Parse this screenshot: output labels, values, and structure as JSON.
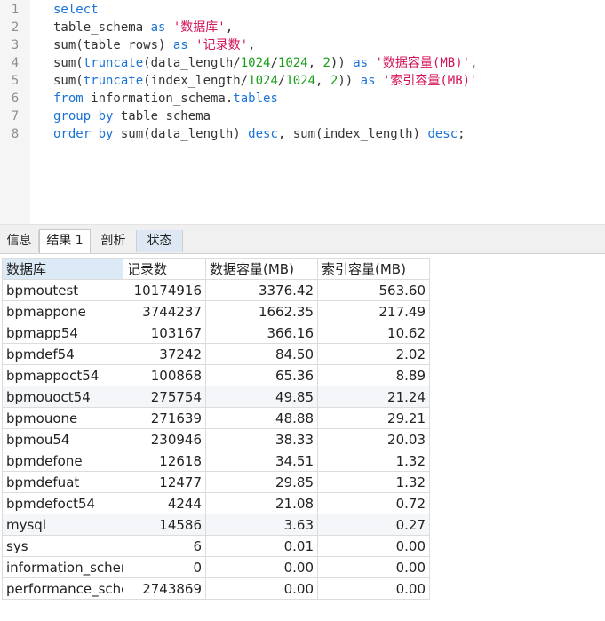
{
  "editor": {
    "lines": [
      {
        "n": "1",
        "tokens": [
          [
            "kw",
            "select"
          ]
        ]
      },
      {
        "n": "2",
        "tokens": [
          [
            "plain",
            "table_schema "
          ],
          [
            "kw",
            "as"
          ],
          [
            "plain",
            " "
          ],
          [
            "str",
            "'数据库'"
          ],
          [
            "plain",
            ","
          ]
        ]
      },
      {
        "n": "3",
        "tokens": [
          [
            "plain",
            "sum(table_rows) "
          ],
          [
            "kw",
            "as"
          ],
          [
            "plain",
            " "
          ],
          [
            "str",
            "'记录数'"
          ],
          [
            "plain",
            ","
          ]
        ]
      },
      {
        "n": "4",
        "tokens": [
          [
            "plain",
            "sum("
          ],
          [
            "fn",
            "truncate"
          ],
          [
            "plain",
            "(data_length/"
          ],
          [
            "num",
            "1024"
          ],
          [
            "plain",
            "/"
          ],
          [
            "num",
            "1024"
          ],
          [
            "plain",
            ", "
          ],
          [
            "num",
            "2"
          ],
          [
            "plain",
            ")) "
          ],
          [
            "kw",
            "as"
          ],
          [
            "plain",
            " "
          ],
          [
            "str",
            "'数据容量(MB)'"
          ],
          [
            "plain",
            ","
          ]
        ]
      },
      {
        "n": "5",
        "tokens": [
          [
            "plain",
            "sum("
          ],
          [
            "fn",
            "truncate"
          ],
          [
            "plain",
            "(index_length/"
          ],
          [
            "num",
            "1024"
          ],
          [
            "plain",
            "/"
          ],
          [
            "num",
            "1024"
          ],
          [
            "plain",
            ", "
          ],
          [
            "num",
            "2"
          ],
          [
            "plain",
            ")) "
          ],
          [
            "kw",
            "as"
          ],
          [
            "plain",
            " "
          ],
          [
            "str",
            "'索引容量(MB)'"
          ]
        ]
      },
      {
        "n": "6",
        "tokens": [
          [
            "kw",
            "from"
          ],
          [
            "plain",
            " information_schema."
          ],
          [
            "fn",
            "tables"
          ]
        ]
      },
      {
        "n": "7",
        "tokens": [
          [
            "kw",
            "group by"
          ],
          [
            "plain",
            " table_schema"
          ]
        ]
      },
      {
        "n": "8",
        "tokens": [
          [
            "kw",
            "order by"
          ],
          [
            "plain",
            " sum(data_length) "
          ],
          [
            "kw",
            "desc"
          ],
          [
            "plain",
            ", sum(index_length) "
          ],
          [
            "kw",
            "desc"
          ],
          [
            "plain",
            ";"
          ]
        ]
      }
    ]
  },
  "tabs": [
    {
      "label": "信息"
    },
    {
      "label": "结果 1"
    },
    {
      "label": "剖析"
    },
    {
      "label": "状态"
    }
  ],
  "grid": {
    "columns": [
      "数据库",
      "记录数",
      "数据容量(MB)",
      "索引容量(MB)"
    ],
    "rows": [
      [
        "bpmoutest",
        "10174916",
        "3376.42",
        "563.60"
      ],
      [
        "bpmappone",
        "3744237",
        "1662.35",
        "217.49"
      ],
      [
        "bpmapp54",
        "103167",
        "366.16",
        "10.62"
      ],
      [
        "bpmdef54",
        "37242",
        "84.50",
        "2.02"
      ],
      [
        "bpmappoct54",
        "100868",
        "65.36",
        "8.89"
      ],
      [
        "bpmouoct54",
        "275754",
        "49.85",
        "21.24"
      ],
      [
        "bpmouone",
        "271639",
        "48.88",
        "29.21"
      ],
      [
        "bpmou54",
        "230946",
        "38.33",
        "20.03"
      ],
      [
        "bpmdefone",
        "12618",
        "34.51",
        "1.32"
      ],
      [
        "bpmdefuat",
        "12477",
        "29.85",
        "1.32"
      ],
      [
        "bpmdefoct54",
        "4244",
        "21.08",
        "0.72"
      ],
      [
        "mysql",
        "14586",
        "3.63",
        "0.27"
      ],
      [
        "sys",
        "6",
        "0.01",
        "0.00"
      ],
      [
        "information_schema",
        "0",
        "0.00",
        "0.00"
      ],
      [
        "performance_schema",
        "2743869",
        "0.00",
        "0.00"
      ]
    ]
  }
}
